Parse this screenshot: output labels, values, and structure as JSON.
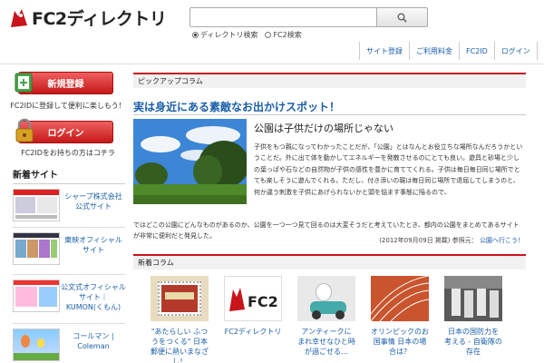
{
  "header": {
    "logo_text": "FC2ディレクトリ",
    "search_placeholder": "",
    "radio_directory": "ディレクトリ検索",
    "radio_fc2": "FC2検索",
    "nav": [
      "サイト登録",
      "ご利用料金",
      "FC2ID",
      "ログイン"
    ]
  },
  "sidebar": {
    "register_label": "新規登録",
    "register_note": "FC2IDに登録して便利に楽しもう！",
    "login_label": "ログイン",
    "login_note": "FC2IDをお持ちの方はコチラ",
    "new_sites_heading": "新着サイト",
    "sites": [
      {
        "label": "シャープ株式会社 公式サイト"
      },
      {
        "label": "東映オフィシャル サイト"
      },
      {
        "label": "公文式オフィシャル サイト｜ KUMON(くもん)"
      },
      {
        "label": "コールマン | Coleman"
      }
    ]
  },
  "pickup": {
    "section_title": "ピックアップコラム",
    "headline": "実は身近にある素敵なお出かけスポット！",
    "subtitle": "公園は子供だけの場所じゃない",
    "body": "子供をもつ親になってわかったことだが、「公園」とはなんとお役立ちな場所なんだろうかということだ。外に出て体を動かしてエネルギーを発散させるのにとても良い。遊具と砂場と少しの葉っぱや石などの自然物が子供の感性を豊かに育ててくれる。子供は毎日毎日同じ場所でとても楽しそうに遊んでくれる。ただし、付き添いの親は毎日同じ場所で退屈してしまうのと、何か違う刺激を子供にあげられないかと頭を悩ます事態に陥るので、",
    "body_cont": "ではどこの公園にどんなものがあるのか、公園を一つ一つ見て回るのは大変そうだと考えていたとき、都内の公園をまとめてあるサイトが非常に便利だと発見した。",
    "date": "(2012年09月09日 掲載)",
    "ref_label": "参照元：",
    "ref_link": "公園へ行こう！"
  },
  "new_columns": {
    "section_title": "新着コラム",
    "cards": [
      {
        "title": "\"あたらしい ふつうをつくる\" 日本郵便に熱いまなざし！"
      },
      {
        "title": "FC2ディレクトリ"
      },
      {
        "title": "アンティークに まれ幸せなひと時 が過ごせる…"
      },
      {
        "title": "オリンピックのお 国事情 日本の場 合は？"
      },
      {
        "title": "日本の国防力を 考える - 自衛隊の 存在"
      }
    ]
  },
  "colors": {
    "accent_red": "#c8141b",
    "link_blue": "#1a5ea8"
  }
}
